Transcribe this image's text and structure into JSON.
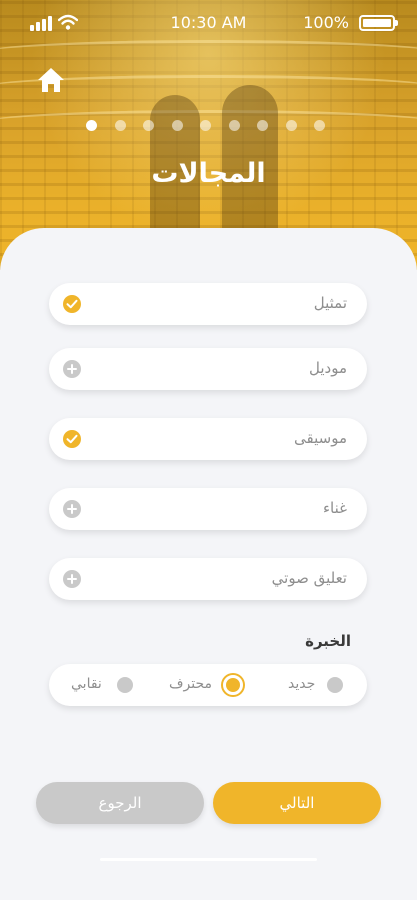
{
  "status_bar": {
    "time": "10:30 AM",
    "battery": "100%"
  },
  "header": {
    "title": "المجالات",
    "steps_total": 9,
    "step_active": 1
  },
  "categories": [
    {
      "label": "تمثيل",
      "selected": true
    },
    {
      "label": "موديل",
      "selected": false
    },
    {
      "label": "موسيقى",
      "selected": true
    },
    {
      "label": "غناء",
      "selected": false
    },
    {
      "label": "تعليق صوتي",
      "selected": false
    }
  ],
  "experience": {
    "title": "الخبرة",
    "options": [
      {
        "label": "جديد",
        "selected": false
      },
      {
        "label": "محترف",
        "selected": true
      },
      {
        "label": "نقابي",
        "selected": false
      }
    ]
  },
  "buttons": {
    "next": "التالي",
    "back": "الرجوع"
  },
  "colors": {
    "accent": "#f0b52a",
    "inactive": "#c9c9c9"
  }
}
